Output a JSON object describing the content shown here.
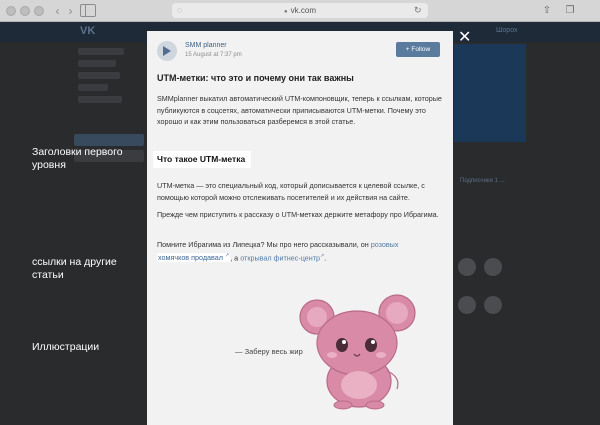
{
  "browser": {
    "url": "vk.com"
  },
  "vk_background": {
    "logo": "VK",
    "header_right": "Шорох",
    "right_text": "Подписчики 1 ..."
  },
  "post": {
    "author": "SMM planner",
    "date": "15 August at 7:37 pm",
    "follow_label": "+ Follow",
    "title": "UTM-метки: что это и почему они так важны",
    "intro": "SMMplanner выкатил автоматический UTM-компоновщик, теперь к ссылкам, которые публикуются в соцсетях, автоматически приписываются UTM-метки. Почему это хорошо и как этим пользоваться разберемся в этой статье.",
    "heading": "Что такое UTM-метка",
    "p2": "UTM-метка — это специальный код, который дописывается к целевой ссылке, с помощью которой можно отслеживать посетителей и их действия на сайте.",
    "p3": "Прежде чем приступить к рассказу о UTM-метках держите метафору про Ибрагима.",
    "p4_start": "Помните Ибрагима из Липецка? Мы про него рассказывали, он ",
    "p4_link1_part1": "розовых",
    "p4_link1_part2": "хомячков продавал",
    "p4_middle": ", а ",
    "p4_link2": "открывал фитнес-центр",
    "p4_end": ".",
    "image_caption": "— Заберу весь жир"
  },
  "annotations": {
    "headings": "Заголовки первого уровня",
    "links": "ссылки на другие статьи",
    "illustrations": "Иллюстрации"
  },
  "icons": [
    "close-icon",
    "lock-icon",
    "share-icon",
    "tabs-icon",
    "back-icon",
    "forward-icon",
    "sidebar-icon",
    "reload-icon",
    "external-link-icon"
  ],
  "colors": {
    "accent": "#5a7a9e",
    "link": "#4f7aa6",
    "hamster": "#d98aa6"
  }
}
